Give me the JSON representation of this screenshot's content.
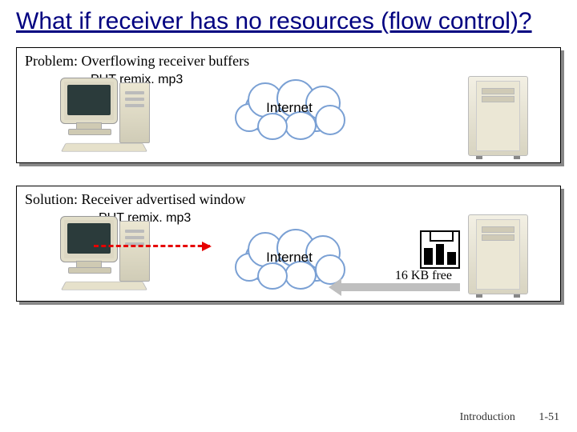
{
  "title": "What if receiver has no resources (flow control)?",
  "problem": {
    "heading": "Problem: Overflowing receiver buffers",
    "command": "PUT remix. mp3",
    "cloud": "Internet"
  },
  "solution": {
    "heading": "Solution: Receiver advertised window",
    "command": "PUT remix. mp3",
    "cloud": "Internet",
    "window_free": "16 KB free"
  },
  "footer": {
    "chapter": "Introduction",
    "page": "1-51"
  }
}
